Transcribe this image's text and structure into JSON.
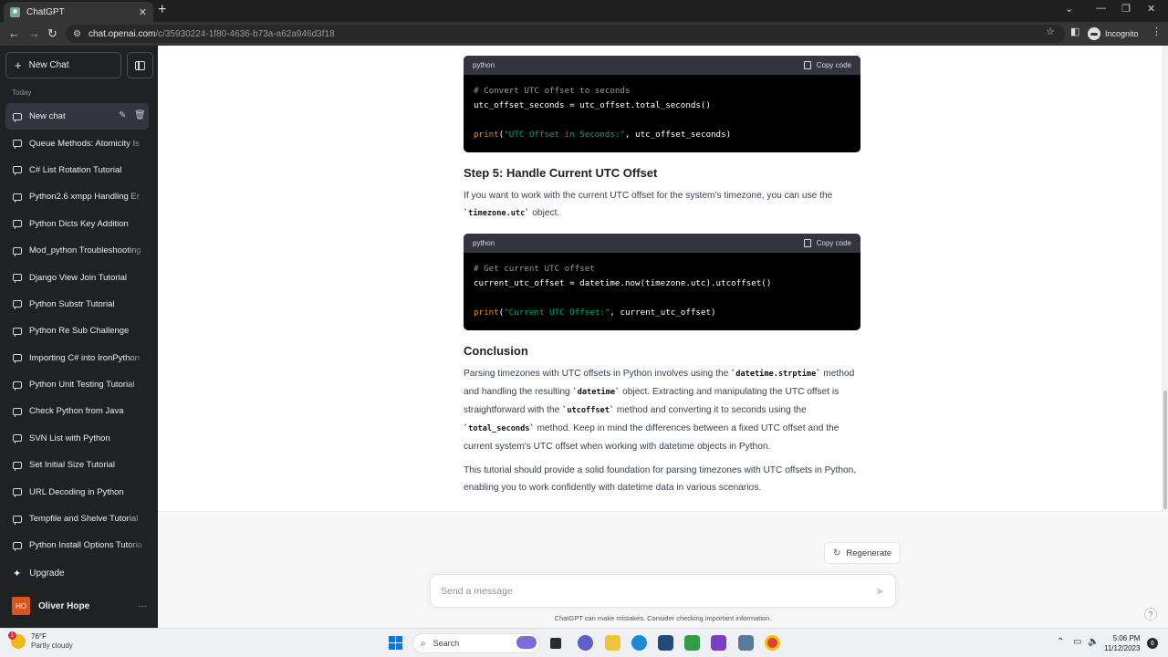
{
  "browser": {
    "tab_title": "ChatGPT",
    "tab_favicon": "chatgpt-logo",
    "url_host": "chat.openai.com",
    "url_path": "/c/35930224-1f80-4636-b73a-a62a946d3f18",
    "incognito_label": "Incognito"
  },
  "sidebar": {
    "new_chat_label": "New Chat",
    "section_label": "Today",
    "active_item": "New chat",
    "items": [
      "Queue Methods: Atomicity Is",
      "C# List Rotation Tutorial",
      "Python2.6 xmpp Handling Er",
      "Python Dicts Key Addition",
      "Mod_python Troubleshooting",
      "Django View Join Tutorial",
      "Python Substr Tutorial",
      "Python Re Sub Challenge",
      "Importing C# into IronPython",
      "Python Unit Testing Tutorial",
      "Check Python from Java",
      "SVN List with Python",
      "Set Initial Size Tutorial",
      "URL Decoding in Python",
      "Tempfile and Shelve Tutorial",
      "Python Install Options Tutoria"
    ],
    "upgrade_label": "Upgrade",
    "user_initials": "HO",
    "user_name": "Oliver Hope"
  },
  "content": {
    "code1": {
      "lang": "python",
      "copy_label": "Copy code",
      "line1": "# Convert UTC offset to seconds",
      "line2": "utc_offset_seconds = utc_offset.total_seconds()",
      "line4_kw": "print",
      "line4_open": "(",
      "line4_str": "\"UTC Offset in Seconds:\"",
      "line4_rest": ", utc_offset_seconds)"
    },
    "step5_heading": "Step 5: Handle Current UTC Offset",
    "step5_text_a": "If you want to work with the current UTC offset for the system's timezone, you can use the",
    "step5_code": "`timezone.utc`",
    "step5_text_b": " object.",
    "code2": {
      "lang": "python",
      "copy_label": "Copy code",
      "line1": "# Get current UTC offset",
      "line2": "current_utc_offset = datetime.now(timezone.utc).utcoffset()",
      "line4_kw": "print",
      "line4_open": "(",
      "line4_str": "\"Current UTC Offset:\"",
      "line4_rest": ", current_utc_offset)"
    },
    "conclusion_heading": "Conclusion",
    "conclusion": {
      "t1": "Parsing timezones with UTC offsets in Python involves using the ",
      "c1": "`datetime.strptime`",
      "t2": " method and handling the resulting ",
      "c2": "`datetime`",
      "t3": " object. Extracting and manipulating the UTC offset is straightforward with the ",
      "c3": "`utcoffset`",
      "t4": " method and converting it to seconds using the ",
      "c4": "`total_seconds`",
      "t5": " method. Keep in mind the differences between a fixed UTC offset and the current system's UTC offset when working with datetime objects in Python."
    },
    "final_para": "This tutorial should provide a solid foundation for parsing timezones with UTC offsets in Python, enabling you to work confidently with datetime data in various scenarios."
  },
  "composer": {
    "regenerate_label": "Regenerate",
    "placeholder": "Send a message",
    "disclaimer": "ChatGPT can make mistakes. Consider checking important information.",
    "help": "?"
  },
  "taskbar": {
    "weather_temp": "76°F",
    "weather_cond": "Partly cloudy",
    "weather_badge": "1",
    "search_label": "Search",
    "time": "5:06 PM",
    "date": "11/12/2023",
    "notif_count": "6"
  },
  "colors": {
    "sidebar_bg": "#202123",
    "code_bg": "#000000",
    "code_header": "#343541",
    "string_green": "#00a67d",
    "keyword_orange": "#e9950c",
    "avatar_orange": "#d9541e"
  }
}
